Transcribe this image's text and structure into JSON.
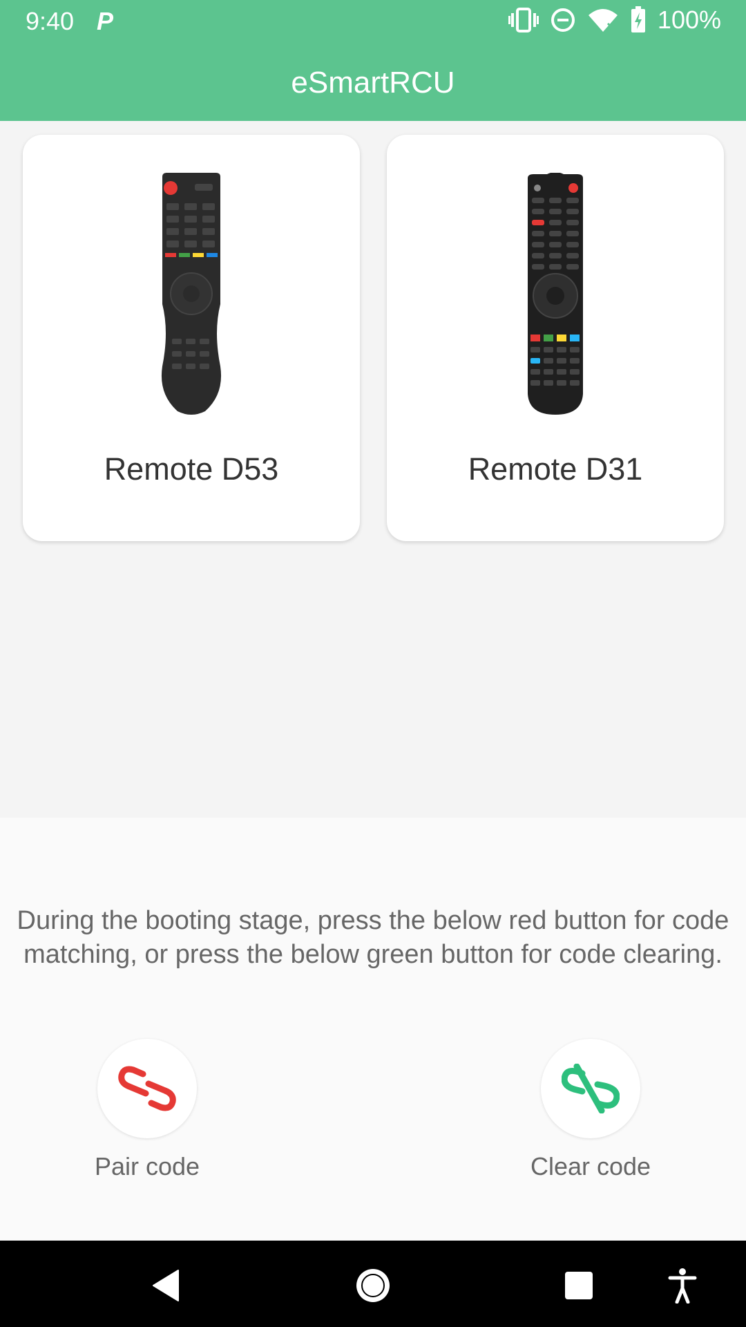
{
  "status_bar": {
    "time": "9:40",
    "notification_icon": "parking-p-icon",
    "battery_text": "100%",
    "icons": [
      "vibrate-icon",
      "do-not-disturb-icon",
      "wifi-icon",
      "battery-charging-icon"
    ]
  },
  "app_bar": {
    "title": "eSmartRCU",
    "color": "#5cc48f"
  },
  "remotes": [
    {
      "label": "Remote D53",
      "image": "remote-d53-icon"
    },
    {
      "label": "Remote D31",
      "image": "remote-d31-icon"
    }
  ],
  "bottom": {
    "instructions": "During the booting stage, press the below red button for code matching, or press the below green button for code clearing.",
    "pair_label": "Pair code",
    "clear_label": "Clear code",
    "pair_color": "#e53935",
    "clear_color": "#2dbf7d"
  },
  "nav_bar": {
    "icons": [
      "back-icon",
      "home-icon",
      "recents-icon",
      "accessibility-icon"
    ]
  }
}
